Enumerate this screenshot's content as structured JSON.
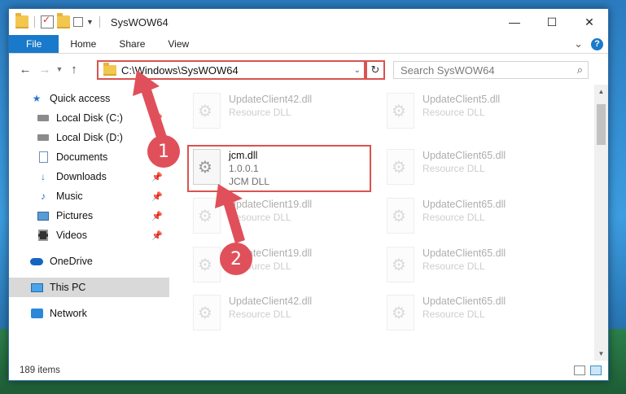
{
  "window": {
    "title": "SysWOW64"
  },
  "titlebar": {
    "minimize": "—",
    "maximize": "☐",
    "close": "✕"
  },
  "ribbon": {
    "tabs": [
      "File",
      "Home",
      "Share",
      "View"
    ],
    "expand": "⌄",
    "help": "?"
  },
  "address": {
    "path": "C:\\Windows\\SysWOW64",
    "search_placeholder": "Search SysWOW64",
    "back": "←",
    "forward": "→",
    "up": "↑",
    "recent": "⌄",
    "refresh": "↻"
  },
  "nav": {
    "items": [
      {
        "label": "Quick access",
        "icon": "star-icon"
      },
      {
        "label": "Local Disk (C:)",
        "icon": "drive-icon",
        "pinned": true
      },
      {
        "label": "Local Disk (D:)",
        "icon": "drive-icon"
      },
      {
        "label": "Documents",
        "icon": "documents-icon",
        "pinned": true
      },
      {
        "label": "Downloads",
        "icon": "downloads-icon",
        "pinned": true
      },
      {
        "label": "Music",
        "icon": "music-icon",
        "pinned": true
      },
      {
        "label": "Pictures",
        "icon": "pictures-icon",
        "pinned": true
      },
      {
        "label": "Videos",
        "icon": "videos-icon",
        "pinned": true
      },
      {
        "label": "OneDrive",
        "icon": "onedrive-icon"
      },
      {
        "label": "This PC",
        "icon": "pc-icon",
        "selected": true
      },
      {
        "label": "Network",
        "icon": "network-icon"
      }
    ]
  },
  "files": [
    {
      "name": "UpdateClient42.dll",
      "type": "Resource DLL"
    },
    {
      "name": "UpdateClient5.dll",
      "type": "Resource DLL"
    },
    {
      "name": "jcm.dll",
      "version": "1.0.0.1",
      "type": "JCM DLL"
    },
    {
      "name": "UpdateClient65.dll",
      "type": "Resource DLL"
    },
    {
      "name": "UpdateClient19.dll",
      "type": "Resource DLL"
    },
    {
      "name": "UpdateClient65.dll",
      "type": "Resource DLL"
    },
    {
      "name": "UpdateClient19.dll",
      "type": "Resource DLL"
    },
    {
      "name": "UpdateClient65.dll",
      "type": "Resource DLL"
    },
    {
      "name": "UpdateClient42.dll",
      "type": "Resource DLL"
    },
    {
      "name": "UpdateClient65.dll",
      "type": "Resource DLL"
    }
  ],
  "status": {
    "item_count": "189 items"
  },
  "annotations": {
    "step1": "1",
    "step2": "2",
    "color": "#e0505a"
  }
}
